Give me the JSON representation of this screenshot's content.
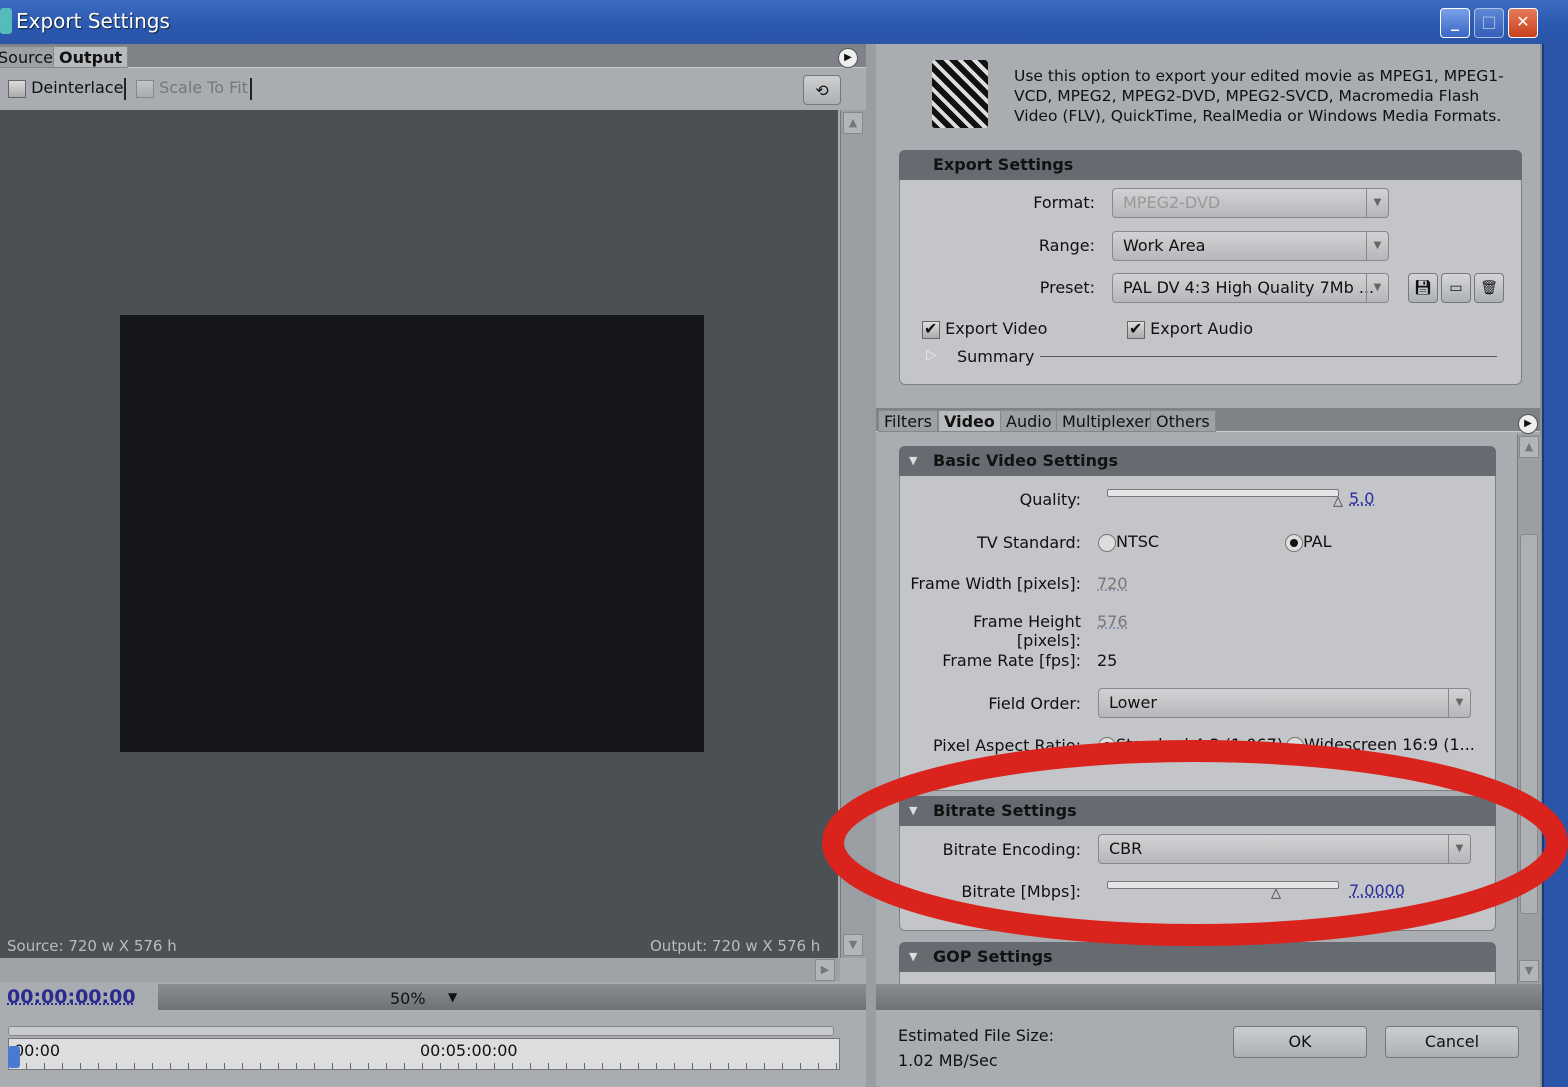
{
  "window": {
    "title": "Export Settings"
  },
  "left": {
    "tabs": [
      {
        "label": "Source"
      },
      {
        "label": "Output"
      }
    ],
    "deinterlace": {
      "label": "Deinterlace",
      "checked": false
    },
    "scale_to_fit": {
      "label": "Scale To Fit",
      "checked": false
    },
    "source_info": "Source: 720 w X 576 h",
    "output_info": "Output: 720 w X 576 h",
    "timecode": "00:00:00:00",
    "zoom": "50%",
    "timeline": {
      "start": "00:00",
      "mid": "00:05:00:00"
    }
  },
  "right": {
    "description": "Use this option to export your edited movie as MPEG1, MPEG1-VCD, MPEG2, MPEG2-DVD, MPEG2-SVCD, Macromedia Flash Video (FLV), QuickTime, RealMedia or Windows Media Formats.",
    "export_settings": {
      "title": "Export Settings",
      "format_label": "Format:",
      "format": "MPEG2-DVD",
      "range_label": "Range:",
      "range": "Work Area",
      "preset_label": "Preset:",
      "preset": "PAL DV 4:3 High Quality 7Mb ...",
      "export_video": "Export Video",
      "export_audio": "Export Audio",
      "summary": "Summary"
    },
    "tabs": [
      {
        "label": "Filters"
      },
      {
        "label": "Video"
      },
      {
        "label": "Audio"
      },
      {
        "label": "Multiplexer"
      },
      {
        "label": "Others"
      }
    ],
    "basic_video": {
      "title": "Basic Video Settings",
      "quality_label": "Quality:",
      "quality": "5.0",
      "quality_fraction": 1.0,
      "tv_label": "TV Standard:",
      "ntsc": "NTSC",
      "pal": "PAL",
      "tv_selected": "PAL",
      "width_label": "Frame Width [pixels]:",
      "width": "720",
      "height_label": "Frame Height [pixels]:",
      "height": "576",
      "rate_label": "Frame Rate [fps]:",
      "rate": "25",
      "field_label": "Field Order:",
      "field": "Lower",
      "par_label": "Pixel Aspect Ratio:",
      "par_standard": "Standard 4:3 (1.067)",
      "par_wide": "Widescreen 16:9 (1..."
    },
    "bitrate": {
      "title": "Bitrate Settings",
      "encoding_label": "Bitrate Encoding:",
      "encoding": "CBR",
      "bitrate_label": "Bitrate [Mbps]:",
      "bitrate": "7.0000",
      "bitrate_fraction": 0.73
    },
    "gop": {
      "title": "GOP Settings"
    },
    "estimated_label": "Estimated File Size:",
    "estimated": "1.02 MB/Sec",
    "ok": "OK",
    "cancel": "Cancel"
  },
  "colors": {
    "annotation": "#d9231c",
    "titlebar": "#2a58b0"
  }
}
